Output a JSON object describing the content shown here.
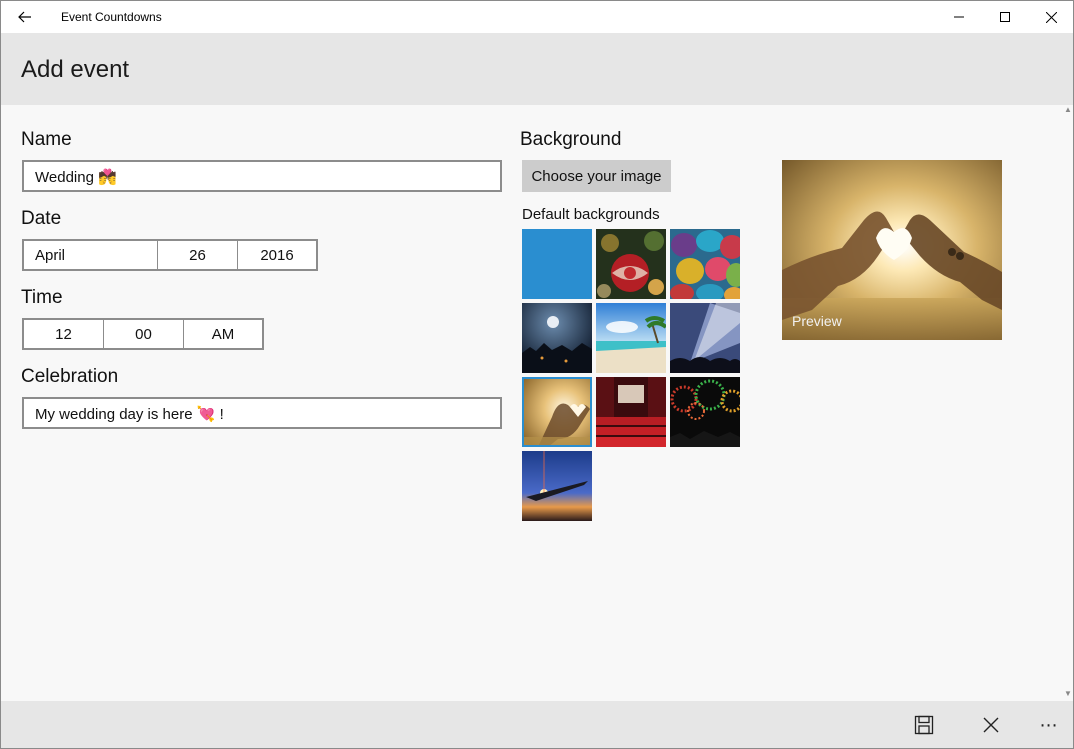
{
  "window": {
    "title": "Event Countdowns"
  },
  "header": {
    "title": "Add event"
  },
  "form": {
    "name_label": "Name",
    "name_value": "Wedding 💏",
    "date_label": "Date",
    "date": {
      "month": "April",
      "day": "26",
      "year": "2016"
    },
    "time_label": "Time",
    "time": {
      "hour": "12",
      "minute": "00",
      "period": "AM"
    },
    "celebration_label": "Celebration",
    "celebration_value": "My wedding day is here 💘 !"
  },
  "background": {
    "label": "Background",
    "choose_button": "Choose your image",
    "default_label": "Default backgrounds",
    "thumbnails": [
      "solid-blue",
      "christmas-ornaments",
      "easter-eggs",
      "night-moon",
      "tropical-beach",
      "concert-lights",
      "heart-hands-sunset",
      "theater-seats",
      "fireworks",
      "airplane-sunrise"
    ],
    "selected": "heart-hands-sunset",
    "preview_label": "Preview"
  },
  "commandbar": {
    "save": "save-icon",
    "cancel": "close-icon",
    "more": "more-icon"
  },
  "colors": {
    "accent": "#2a8ed0",
    "header_bg": "#e6e6e6",
    "button_bg": "#cccccc"
  }
}
